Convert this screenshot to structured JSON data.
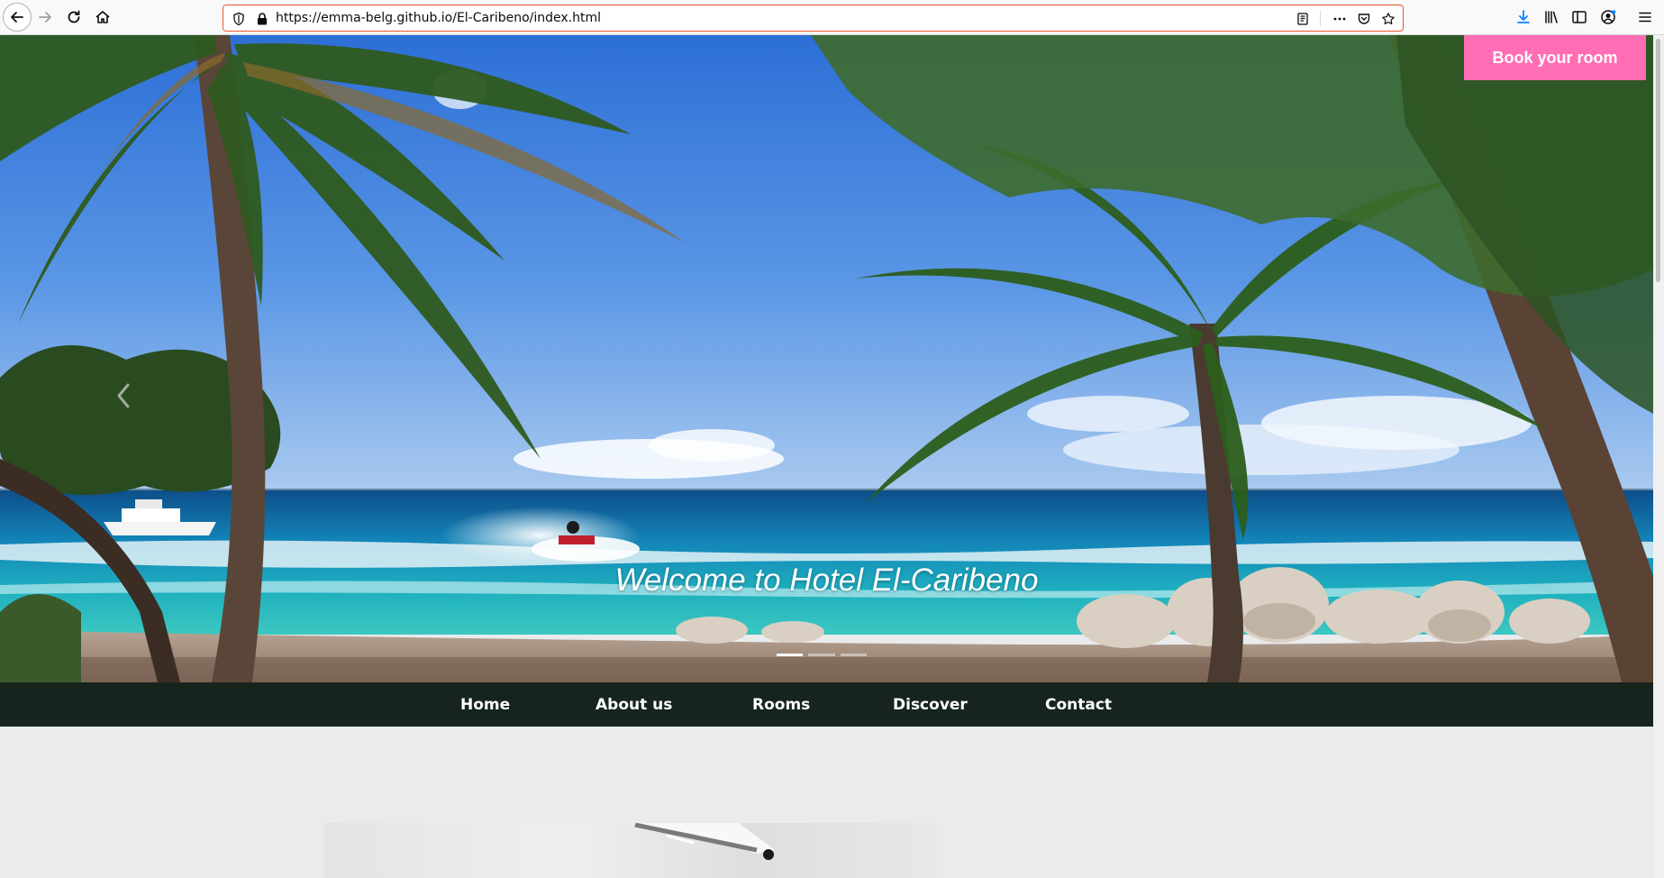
{
  "browser": {
    "url": "https://emma-belg.github.io/El-Caribeno/index.html",
    "icons": [
      "back-icon",
      "forward-icon",
      "reload-icon",
      "home-icon",
      "tracking-shield-icon",
      "lock-icon",
      "reader-view-icon",
      "more-actions-icon",
      "pocket-icon",
      "bookmark-star-icon",
      "download-icon",
      "library-icon",
      "sidebar-icon",
      "account-icon",
      "menu-icon"
    ]
  },
  "hero": {
    "caption": "Welcome to Hotel El-Caribeno",
    "slides_count": 3,
    "active_slide": 1
  },
  "cta": {
    "book_label": "Book your room",
    "color": "#ff6eb4"
  },
  "nav": {
    "items": [
      {
        "label": "Home"
      },
      {
        "label": "About us"
      },
      {
        "label": "Rooms"
      },
      {
        "label": "Discover"
      },
      {
        "label": "Contact"
      }
    ],
    "background": "#17241d"
  },
  "page": {
    "background": "#e9ebec"
  }
}
